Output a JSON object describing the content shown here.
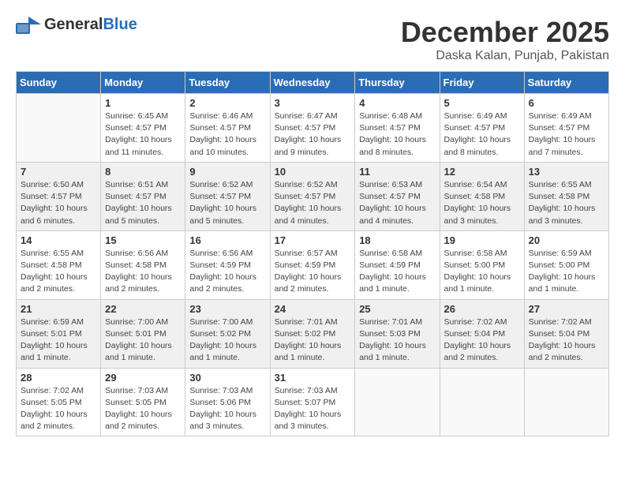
{
  "header": {
    "logo_general": "General",
    "logo_blue": "Blue",
    "month_title": "December 2025",
    "location": "Daska Kalan, Punjab, Pakistan"
  },
  "weekdays": [
    "Sunday",
    "Monday",
    "Tuesday",
    "Wednesday",
    "Thursday",
    "Friday",
    "Saturday"
  ],
  "weeks": [
    [
      {
        "day": "",
        "info": ""
      },
      {
        "day": "1",
        "info": "Sunrise: 6:45 AM\nSunset: 4:57 PM\nDaylight: 10 hours\nand 11 minutes."
      },
      {
        "day": "2",
        "info": "Sunrise: 6:46 AM\nSunset: 4:57 PM\nDaylight: 10 hours\nand 10 minutes."
      },
      {
        "day": "3",
        "info": "Sunrise: 6:47 AM\nSunset: 4:57 PM\nDaylight: 10 hours\nand 9 minutes."
      },
      {
        "day": "4",
        "info": "Sunrise: 6:48 AM\nSunset: 4:57 PM\nDaylight: 10 hours\nand 8 minutes."
      },
      {
        "day": "5",
        "info": "Sunrise: 6:49 AM\nSunset: 4:57 PM\nDaylight: 10 hours\nand 8 minutes."
      },
      {
        "day": "6",
        "info": "Sunrise: 6:49 AM\nSunset: 4:57 PM\nDaylight: 10 hours\nand 7 minutes."
      }
    ],
    [
      {
        "day": "7",
        "info": "Sunrise: 6:50 AM\nSunset: 4:57 PM\nDaylight: 10 hours\nand 6 minutes."
      },
      {
        "day": "8",
        "info": "Sunrise: 6:51 AM\nSunset: 4:57 PM\nDaylight: 10 hours\nand 5 minutes."
      },
      {
        "day": "9",
        "info": "Sunrise: 6:52 AM\nSunset: 4:57 PM\nDaylight: 10 hours\nand 5 minutes."
      },
      {
        "day": "10",
        "info": "Sunrise: 6:52 AM\nSunset: 4:57 PM\nDaylight: 10 hours\nand 4 minutes."
      },
      {
        "day": "11",
        "info": "Sunrise: 6:53 AM\nSunset: 4:57 PM\nDaylight: 10 hours\nand 4 minutes."
      },
      {
        "day": "12",
        "info": "Sunrise: 6:54 AM\nSunset: 4:58 PM\nDaylight: 10 hours\nand 3 minutes."
      },
      {
        "day": "13",
        "info": "Sunrise: 6:55 AM\nSunset: 4:58 PM\nDaylight: 10 hours\nand 3 minutes."
      }
    ],
    [
      {
        "day": "14",
        "info": "Sunrise: 6:55 AM\nSunset: 4:58 PM\nDaylight: 10 hours\nand 2 minutes."
      },
      {
        "day": "15",
        "info": "Sunrise: 6:56 AM\nSunset: 4:58 PM\nDaylight: 10 hours\nand 2 minutes."
      },
      {
        "day": "16",
        "info": "Sunrise: 6:56 AM\nSunset: 4:59 PM\nDaylight: 10 hours\nand 2 minutes."
      },
      {
        "day": "17",
        "info": "Sunrise: 6:57 AM\nSunset: 4:59 PM\nDaylight: 10 hours\nand 2 minutes."
      },
      {
        "day": "18",
        "info": "Sunrise: 6:58 AM\nSunset: 4:59 PM\nDaylight: 10 hours\nand 1 minute."
      },
      {
        "day": "19",
        "info": "Sunrise: 6:58 AM\nSunset: 5:00 PM\nDaylight: 10 hours\nand 1 minute."
      },
      {
        "day": "20",
        "info": "Sunrise: 6:59 AM\nSunset: 5:00 PM\nDaylight: 10 hours\nand 1 minute."
      }
    ],
    [
      {
        "day": "21",
        "info": "Sunrise: 6:59 AM\nSunset: 5:01 PM\nDaylight: 10 hours\nand 1 minute."
      },
      {
        "day": "22",
        "info": "Sunrise: 7:00 AM\nSunset: 5:01 PM\nDaylight: 10 hours\nand 1 minute."
      },
      {
        "day": "23",
        "info": "Sunrise: 7:00 AM\nSunset: 5:02 PM\nDaylight: 10 hours\nand 1 minute."
      },
      {
        "day": "24",
        "info": "Sunrise: 7:01 AM\nSunset: 5:02 PM\nDaylight: 10 hours\nand 1 minute."
      },
      {
        "day": "25",
        "info": "Sunrise: 7:01 AM\nSunset: 5:03 PM\nDaylight: 10 hours\nand 1 minute."
      },
      {
        "day": "26",
        "info": "Sunrise: 7:02 AM\nSunset: 5:04 PM\nDaylight: 10 hours\nand 2 minutes."
      },
      {
        "day": "27",
        "info": "Sunrise: 7:02 AM\nSunset: 5:04 PM\nDaylight: 10 hours\nand 2 minutes."
      }
    ],
    [
      {
        "day": "28",
        "info": "Sunrise: 7:02 AM\nSunset: 5:05 PM\nDaylight: 10 hours\nand 2 minutes."
      },
      {
        "day": "29",
        "info": "Sunrise: 7:03 AM\nSunset: 5:05 PM\nDaylight: 10 hours\nand 2 minutes."
      },
      {
        "day": "30",
        "info": "Sunrise: 7:03 AM\nSunset: 5:06 PM\nDaylight: 10 hours\nand 3 minutes."
      },
      {
        "day": "31",
        "info": "Sunrise: 7:03 AM\nSunset: 5:07 PM\nDaylight: 10 hours\nand 3 minutes."
      },
      {
        "day": "",
        "info": ""
      },
      {
        "day": "",
        "info": ""
      },
      {
        "day": "",
        "info": ""
      }
    ]
  ]
}
